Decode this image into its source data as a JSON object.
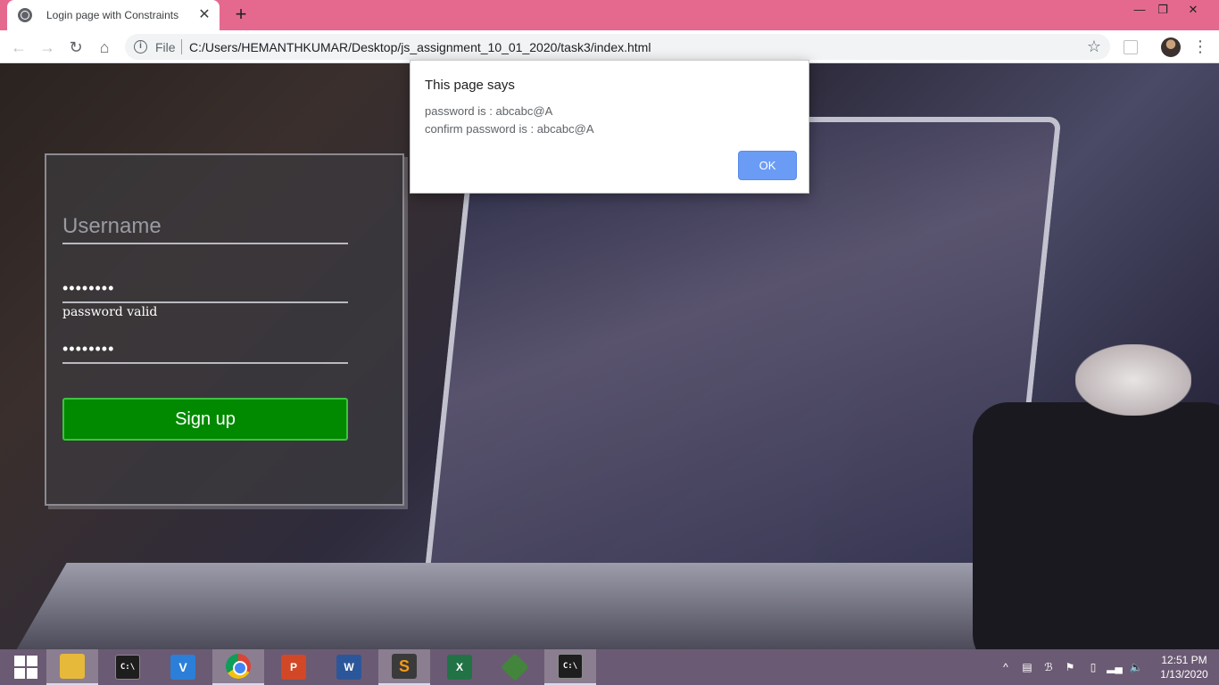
{
  "browser": {
    "tab_title": "Login page with Constraints",
    "tab_close": "✕",
    "new_tab": "+",
    "url_scheme_label": "File",
    "url": "C:/Users/HEMANTHKUMAR/Desktop/js_assignment_10_01_2020/task3/index.html",
    "window_controls": {
      "minimize": "—",
      "maximize": "❐",
      "close": "✕"
    }
  },
  "form": {
    "username_placeholder": "Username",
    "password_value": "abcabc@A",
    "password_status": "password valid",
    "confirm_value": "abcabc@A",
    "signup_label": "Sign up",
    "signup_color": "#018a00"
  },
  "alert": {
    "title": "This page says",
    "line1": "password is : abcabc@A",
    "line2": "confirm password is : abcabc@A",
    "ok_label": "OK",
    "ok_color": "#6b9cf5"
  },
  "taskbar": {
    "apps": [
      "start",
      "file-explorer",
      "command-prompt",
      "vscode",
      "chrome",
      "powerpoint",
      "word",
      "sublime-text",
      "excel",
      "nodejs",
      "command-prompt"
    ],
    "active_app": "chrome",
    "time": "12:51 PM",
    "date": "1/13/2020"
  },
  "colors": {
    "title_bar": "#e5698f",
    "taskbar": "#6b5a73"
  }
}
